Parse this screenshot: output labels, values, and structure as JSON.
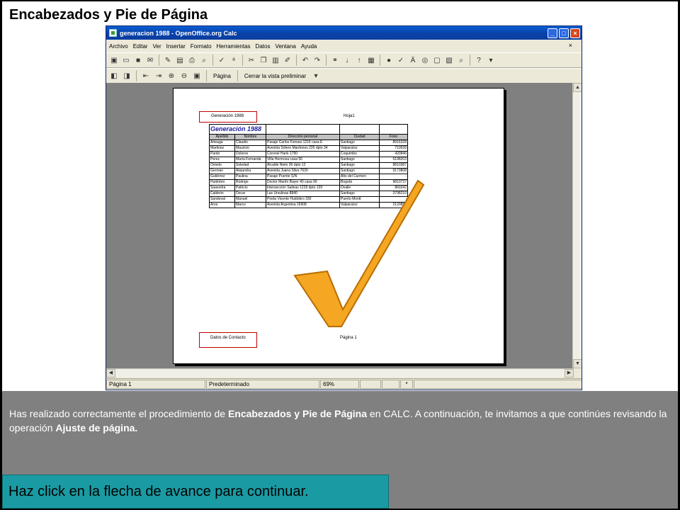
{
  "slide": {
    "title": "Encabezados y Pie de Página"
  },
  "window": {
    "title": "generacion 1988 - OpenOffice.org Calc",
    "menu": [
      "Archivo",
      "Editar",
      "Ver",
      "Insertar",
      "Formato",
      "Herramientas",
      "Datos",
      "Ventana",
      "Ayuda"
    ],
    "preview_toolbar": {
      "page_button": "Página",
      "close_preview_button": "Cerrar la vista preliminar"
    },
    "status": {
      "page": "Página 1",
      "style": "Predeterminado",
      "zoom": "69%",
      "modified": "*"
    }
  },
  "preview": {
    "header_left": "Generación 1988",
    "header_center": "Hoja1",
    "footer_left": "Datos de Contacto",
    "footer_center": "Página 1",
    "sheet_title": "Generación 1988",
    "columns": [
      "Apellido",
      "Nombre",
      "Dirección personal",
      "Ciudad",
      "Fono"
    ],
    "rows": [
      [
        "Arteaga",
        "Claudio",
        "Pasaje Carlos Fonsea 1216 casa E",
        "Santiago",
        "8916328"
      ],
      [
        "Martinez",
        "Mauricio",
        "Avenida Sótero Mardones 220 dpto 34",
        "Valparaíso",
        "710539"
      ],
      [
        "Pardo",
        "Dolores",
        "Coronel Hank 1790",
        "Coquimbo",
        "420846"
      ],
      [
        "Perez",
        "María Fernanda",
        "Villa Hermosa casa 56",
        "Santiago",
        "5198203"
      ],
      [
        "Oviedo",
        "Soledad",
        "Alcalde Nieto 90 dpto 12",
        "Santiago",
        "8810387"
      ],
      [
        "German",
        "Alejandra",
        "Avenida Juana Silva 7630",
        "Santiago",
        "9173808"
      ],
      [
        "Gutiérrez",
        "Paulina",
        "Pasaje Puente S/N",
        "Alto del Carmen",
        "-"
      ],
      [
        "Huidobro",
        "Rodrigo",
        "Doctor Martín Bayer 40 casa 90",
        "Bogotá",
        "9810737"
      ],
      [
        "Saavedra",
        "Patricio",
        "Intersección Salinas 1229 dpto 139",
        "Ovalle",
        "860342"
      ],
      [
        "Caldeón",
        "Oscar",
        "Las Ursulinas 8840",
        "Santiago",
        "3798210"
      ],
      [
        "Sandoval",
        "Manuel",
        "Poeta Vicente Huidobro 330",
        "Puerto Montt",
        "-"
      ],
      [
        "Aros",
        "Marco",
        "Avenida Argentina 16908",
        "Valparaíso",
        "2120891"
      ]
    ]
  },
  "info": {
    "text_1": "Has realizado correctamente el procedimiento de ",
    "bold_1": "Encabezados y Pie de Página",
    "text_2": "  en CALC. A continuación, te invitamos a que continúes revisando la operación ",
    "bold_2": "Ajuste de página."
  },
  "cta": {
    "label": "Haz click en la flecha de avance para continuar."
  },
  "colors": {
    "panel_gray": "#808080",
    "cta_teal": "#1a9ba3",
    "check_orange": "#f5a623",
    "highlight_red": "#c00000"
  }
}
